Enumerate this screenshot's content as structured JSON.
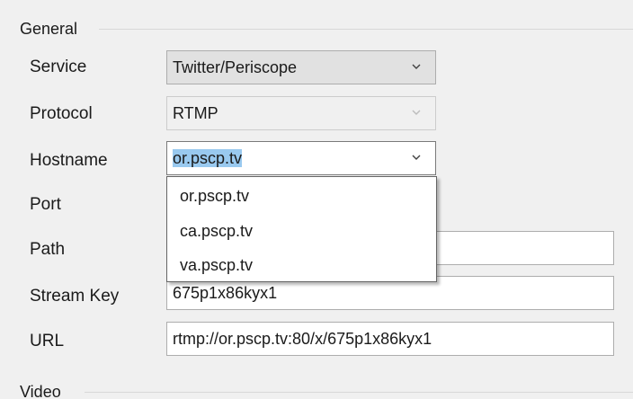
{
  "groups": {
    "general": "General",
    "video": "Video"
  },
  "fields": {
    "service": {
      "label": "Service",
      "value": "Twitter/Periscope"
    },
    "protocol": {
      "label": "Protocol",
      "value": "RTMP"
    },
    "hostname": {
      "label": "Hostname",
      "value": "or.pscp.tv"
    },
    "port": {
      "label": "Port"
    },
    "path": {
      "label": "Path",
      "value": ""
    },
    "stream_key": {
      "label": "Stream Key",
      "value": "675p1x86kyx1"
    },
    "url": {
      "label": "URL",
      "value": "rtmp://or.pscp.tv:80/x/675p1x86kyx1"
    }
  },
  "hostname_options": [
    "or.pscp.tv",
    "ca.pscp.tv",
    "va.pscp.tv"
  ],
  "icons": {
    "dropdown": "chevron-down-icon"
  },
  "colors": {
    "selection_highlight": "#99c9ef",
    "background": "#f0f0f0"
  }
}
